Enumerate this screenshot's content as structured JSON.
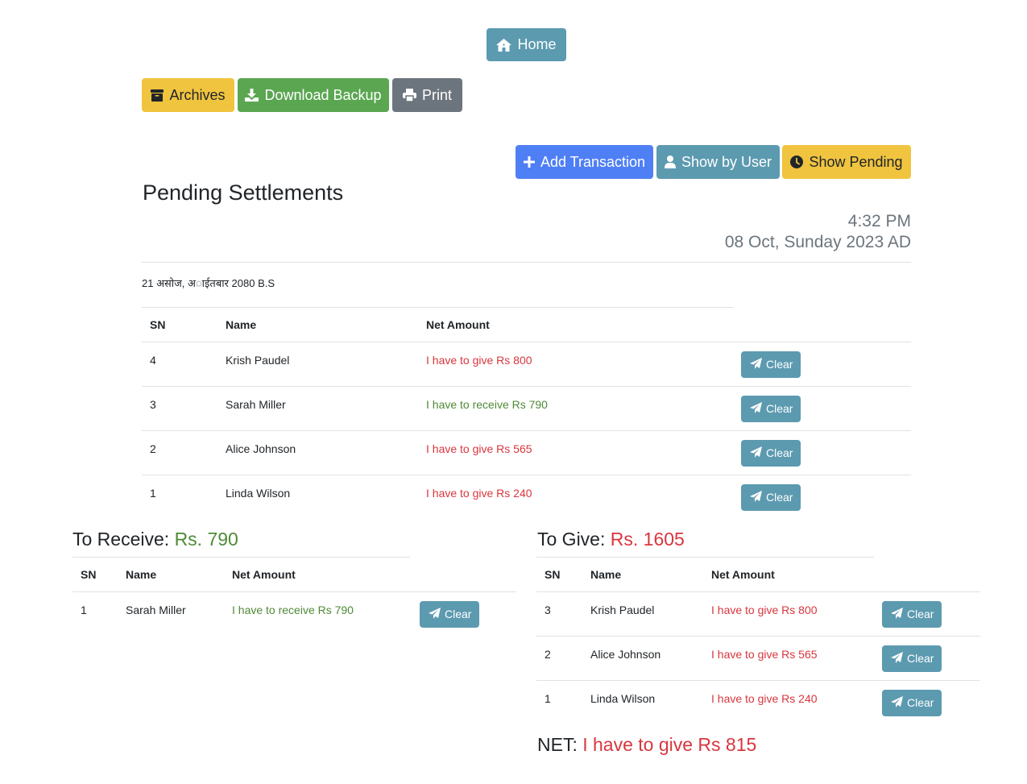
{
  "nav": {
    "home_label": "Home",
    "archives_label": "Archives",
    "download_label": "Download Backup",
    "print_label": "Print"
  },
  "actions": {
    "add_label": "Add Transaction",
    "show_user_label": "Show by User",
    "show_pending_label": "Show Pending"
  },
  "page": {
    "title": "Pending Settlements",
    "time": "4:32 PM",
    "date": "08 Oct, Sunday 2023 AD",
    "nepali_date": "21 असोज, अाईतबार 2080 B.S"
  },
  "columns": {
    "sn": "SN",
    "name": "Name",
    "net": "Net Amount"
  },
  "clear_label": "Clear",
  "main_rows": [
    {
      "sn": "4",
      "name": "Krish Paudel",
      "net": "I have to give Rs 800",
      "type": "give"
    },
    {
      "sn": "3",
      "name": "Sarah Miller",
      "net": "I have to receive Rs 790",
      "type": "receive"
    },
    {
      "sn": "2",
      "name": "Alice Johnson",
      "net": "I have to give Rs 565",
      "type": "give"
    },
    {
      "sn": "1",
      "name": "Linda Wilson",
      "net": "I have to give Rs 240",
      "type": "give"
    }
  ],
  "receive": {
    "label": "To Receive:",
    "amount": "Rs. 790",
    "rows": [
      {
        "sn": "1",
        "name": "Sarah Miller",
        "net": "I have to receive Rs 790",
        "type": "receive"
      }
    ]
  },
  "give": {
    "label": "To Give:",
    "amount": "Rs. 1605",
    "rows": [
      {
        "sn": "3",
        "name": "Krish Paudel",
        "net": "I have to give Rs 800",
        "type": "give"
      },
      {
        "sn": "2",
        "name": "Alice Johnson",
        "net": "I have to give Rs 565",
        "type": "give"
      },
      {
        "sn": "1",
        "name": "Linda Wilson",
        "net": "I have to give Rs 240",
        "type": "give"
      }
    ]
  },
  "net": {
    "label": "NET:",
    "value": "I have to give Rs 815"
  },
  "colors": {
    "give": "#d9363e",
    "receive": "#4e8a36",
    "info": "#5c9ab0",
    "warning": "#f0c43f",
    "success": "#5aa651",
    "primary": "#4f7ff5",
    "secondary": "#6c757d"
  }
}
